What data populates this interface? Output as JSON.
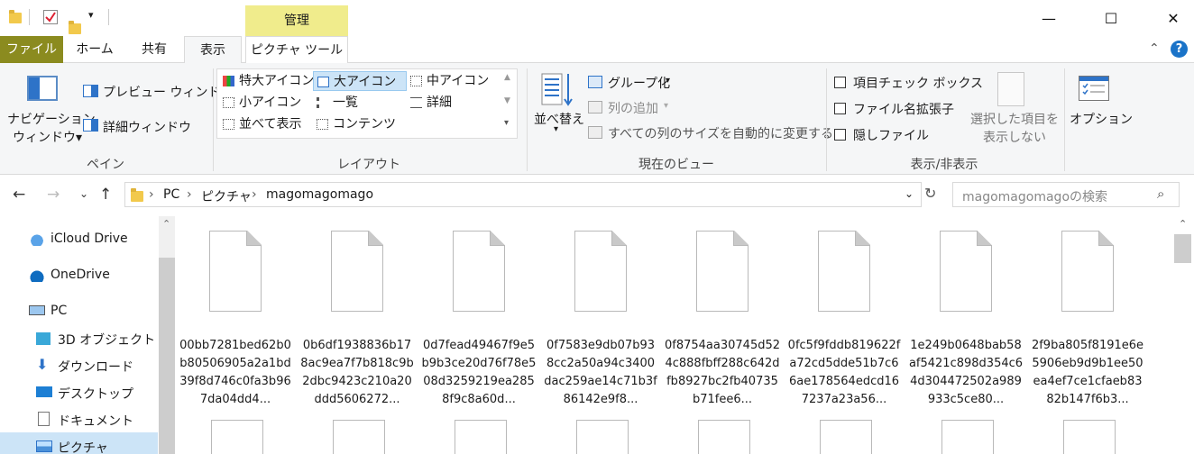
{
  "window": {
    "context_tab_header": "管理",
    "minimize": "—",
    "maximize": "☐",
    "close": "✕"
  },
  "tabs": {
    "file": "ファイル",
    "home": "ホーム",
    "share": "共有",
    "view": "表示",
    "picture_tools": "ピクチャ ツール"
  },
  "ribbon": {
    "pane": {
      "nav_pane_line1": "ナビゲーション",
      "nav_pane_line2": "ウィンドウ▾",
      "preview_pane": "プレビュー ウィンドウ",
      "details_pane": "詳細ウィンドウ",
      "group_label": "ペイン"
    },
    "layout": {
      "extra_large": "特大アイコン",
      "large": "大アイコン",
      "medium": "中アイコン",
      "small": "小アイコン",
      "list": "一覧",
      "details": "詳細",
      "tiles": "並べて表示",
      "content": "コンテンツ",
      "group_label": "レイアウト"
    },
    "current_view": {
      "sort_by_line1": "並べ替え",
      "group_by": "グループ化",
      "add_columns": "列の追加",
      "size_columns": "すべての列のサイズを自動的に変更する",
      "group_label": "現在のビュー"
    },
    "show_hide": {
      "item_checkboxes": "項目チェック ボックス",
      "file_extensions": "ファイル名拡張子",
      "hidden_items": "隠しファイル",
      "hide_selected_line1": "選択した項目を",
      "hide_selected_line2": "表示しない",
      "group_label": "表示/非表示"
    },
    "options": "オプション"
  },
  "address": {
    "crumbs": [
      "PC",
      "ピクチャ",
      "magomagomago"
    ],
    "search_placeholder": "magomagomagoの検索"
  },
  "nav": {
    "items": [
      "iCloud Drive",
      "OneDrive",
      "PC",
      "3D オブジェクト",
      "ダウンロード",
      "デスクトップ",
      "ドキュメント",
      "ピクチャ"
    ]
  },
  "files": [
    "00bb7281bed62b0b80506905a2a1bd39f8d746c0fa3b967da04dd4...",
    "0b6df1938836b178ac9ea7f7b818c9b2dbc9423c210a20ddd5606272...",
    "0d7fead49467f9e5b9b3ce20d76f78e508d3259219ea2858f9c8a60d...",
    "0f7583e9db07b938cc2a50a94c3400dac259ae14c71b3f86142e9f8...",
    "0f8754aa30745d524c888fbff288c642dfb8927bc2fb40735b71fee6...",
    "0fc5f9fddb819622fa72cd5dde51b7c66ae178564edcd167237a23a56...",
    "1e249b0648bab58af5421c898d354c64d304472502a989933c5ce80...",
    "2f9ba805f8191e6e5906eb9d9b1ee50ea4ef7ce1cfaeb8382b147f6b3..."
  ],
  "colors": {
    "file_tab": "#8b8b1f",
    "context_tab": "#f0ec8c",
    "selected": "#cce4f7",
    "help": "#1a73c8"
  }
}
